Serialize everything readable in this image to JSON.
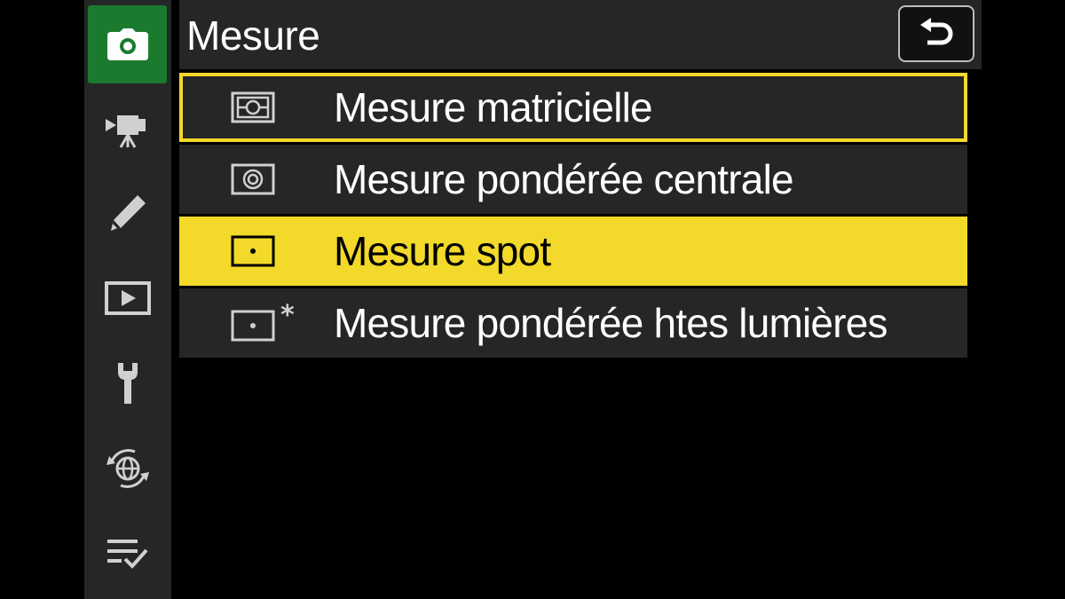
{
  "header": {
    "title": "Mesure"
  },
  "sidebar": {
    "items": [
      {
        "icon": "camera-icon",
        "active": true
      },
      {
        "icon": "movie-camera-icon"
      },
      {
        "icon": "pencil-icon"
      },
      {
        "icon": "playback-icon"
      },
      {
        "icon": "wrench-icon"
      },
      {
        "icon": "network-icon"
      },
      {
        "icon": "my-menu-icon"
      }
    ]
  },
  "menu": {
    "items": [
      {
        "label": "Mesure matricielle",
        "icon": "matrix-metering-icon",
        "state": "focused"
      },
      {
        "label": "Mesure pondérée centrale",
        "icon": "center-weighted-metering-icon"
      },
      {
        "label": "Mesure spot",
        "icon": "spot-metering-icon",
        "state": "selected"
      },
      {
        "label": "Mesure pondérée htes lumières",
        "icon": "highlight-weighted-metering-icon"
      }
    ]
  },
  "colors": {
    "accent": "#f2d92a",
    "active_tab": "#1a7a2e",
    "panel": "#262626"
  }
}
